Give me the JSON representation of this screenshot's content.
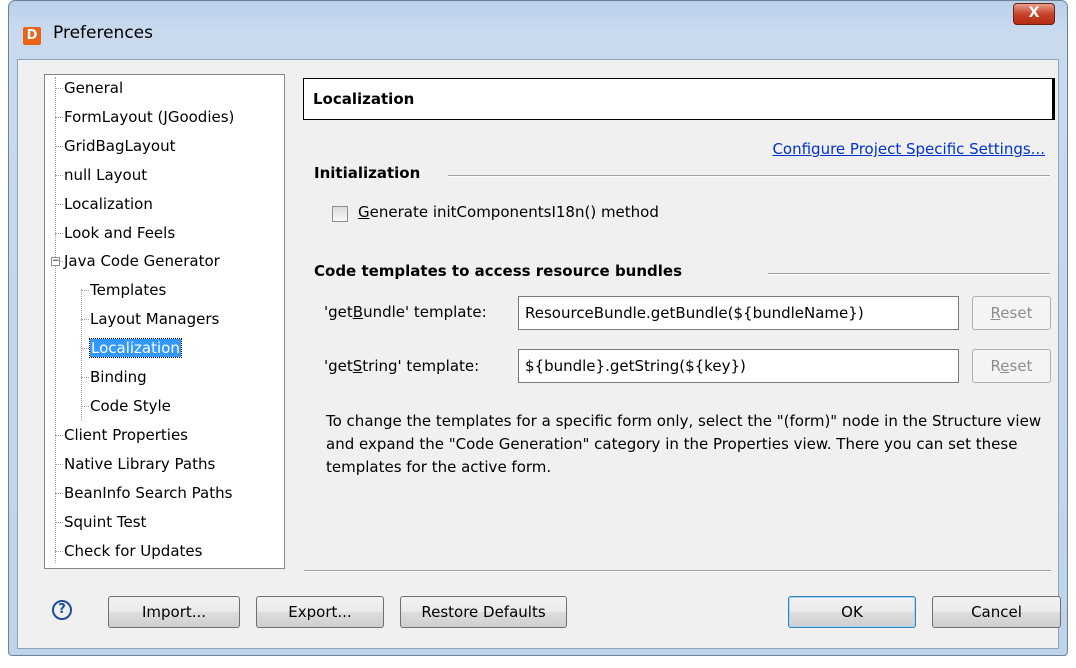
{
  "window": {
    "title": "Preferences",
    "app_icon": "jformdesigner-icon",
    "close_label": "X"
  },
  "tree": {
    "items": [
      {
        "label": "General",
        "level": 0
      },
      {
        "label": "FormLayout (JGoodies)",
        "level": 0
      },
      {
        "label": "GridBagLayout",
        "level": 0
      },
      {
        "label": "null Layout",
        "level": 0
      },
      {
        "label": "Localization",
        "level": 0
      },
      {
        "label": "Look and Feels",
        "level": 0
      },
      {
        "label": "Java Code Generator",
        "level": 0,
        "expanded": true
      },
      {
        "label": "Templates",
        "level": 1
      },
      {
        "label": "Layout Managers",
        "level": 1
      },
      {
        "label": "Localization",
        "level": 1,
        "selected": true
      },
      {
        "label": "Binding",
        "level": 1
      },
      {
        "label": "Code Style",
        "level": 1
      },
      {
        "label": "Client Properties",
        "level": 0
      },
      {
        "label": "Native Library Paths",
        "level": 0
      },
      {
        "label": "BeanInfo Search Paths",
        "level": 0
      },
      {
        "label": "Squint Test",
        "level": 0
      },
      {
        "label": "Check for Updates",
        "level": 0
      }
    ]
  },
  "panel": {
    "header": "Localization",
    "project_link": "Configure Project Specific Settings...",
    "init_section": "Initialization",
    "generate_checkbox": {
      "mnemonic": "G",
      "rest": "enerate initComponentsI18n() method",
      "checked": false
    },
    "templates_section": "Code templates to access resource bundles",
    "get_bundle": {
      "label_pre": "'get",
      "label_mn": "B",
      "label_post": "undle' template:",
      "value": "ResourceBundle.getBundle(${bundleName})",
      "reset_pre": "",
      "reset_mn": "R",
      "reset_post": "eset"
    },
    "get_string": {
      "label_pre": "'get",
      "label_mn": "S",
      "label_post": "tring' template:",
      "value": "${bundle}.getString(${key})",
      "reset_pre": "R",
      "reset_mn": "e",
      "reset_post": "set"
    },
    "info_text": "To change the templates for a specific form only, select the \"(form)\" node in the Structure view and expand the \"Code Generation\" category in the Properties view. There you can set these templates for the active form."
  },
  "footer": {
    "help_icon": "help-icon",
    "help_glyph": "?",
    "import": "Import...",
    "export": "Export...",
    "restore": "Restore Defaults",
    "ok": "OK",
    "cancel": "Cancel"
  }
}
